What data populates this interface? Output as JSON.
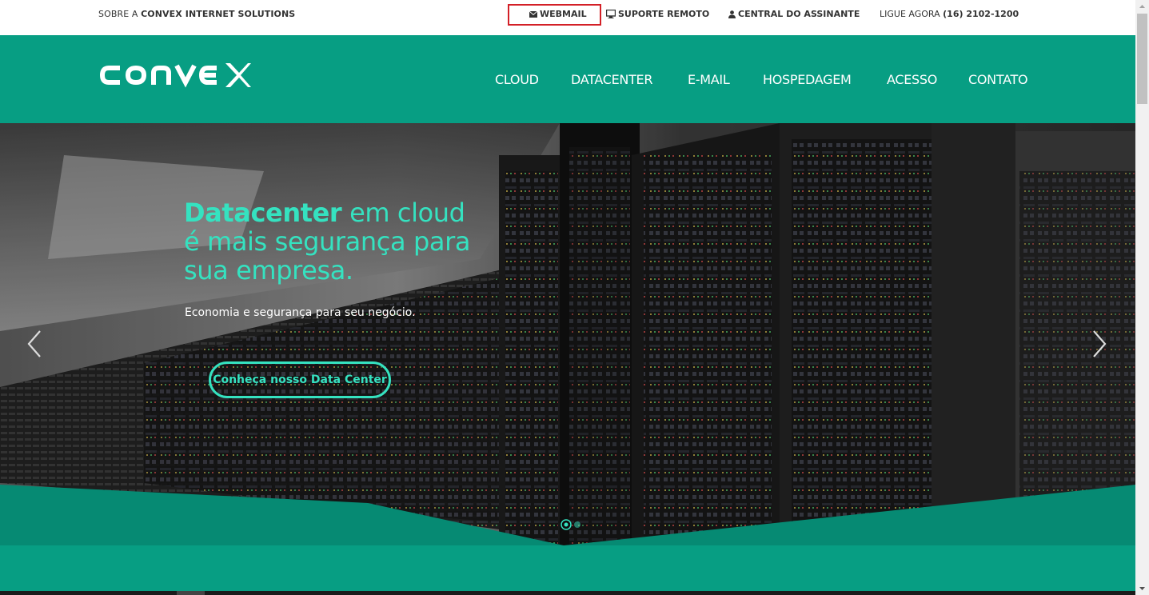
{
  "topbar": {
    "about_prefix": "SOBRE A ",
    "about_bold": "CONVEX INTERNET SOLUTIONS",
    "webmail": "WEBMAIL",
    "remote_support": "SUPORTE REMOTO",
    "subscriber": "CENTRAL DO ASSINANTE",
    "call_prefix": "LIGUE AGORA ",
    "phone": "(16) 2102-1200"
  },
  "header": {
    "logo": "CONVEX",
    "nav": [
      "CLOUD",
      "DATACENTER",
      "E-MAIL",
      "HOSPEDAGEM",
      "ACESSO",
      "CONTATO"
    ]
  },
  "hero": {
    "title_bold": "Datacenter",
    "title_rest": " em cloud",
    "title_line2": "é mais segurança para",
    "title_line3": "sua empresa.",
    "subtitle": "Economia e segurança para seu negócio.",
    "cta": "Conheça nosso Data Center"
  },
  "colors": {
    "brand_teal": "#079e83",
    "accent": "#35e2c0",
    "highlight": "#d32027"
  }
}
